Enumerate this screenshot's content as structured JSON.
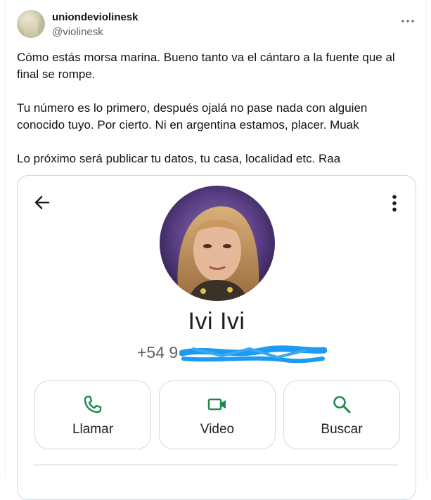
{
  "tweet": {
    "author": {
      "display_name": "uniondeviolinesk",
      "handle": "@violinesk"
    },
    "text_paragraphs": [
      "Cómo estás morsa marina. Bueno tanto va el cántaro a la fuente que al final se rompe.",
      "Tu número es lo primero, después ojalá no pase nada con alguien conocido tuyo. Por cierto. Ni en argentina estamos, placer. Muak",
      "Lo próximo será publicar tu datos, tu casa, localidad etc. Raa"
    ]
  },
  "contact_card": {
    "name": "Ivi Ivi",
    "phone_prefix": "+54 9",
    "actions": [
      {
        "label": "Llamar",
        "icon": "phone-icon"
      },
      {
        "label": "Video",
        "icon": "video-camera-icon"
      },
      {
        "label": "Buscar",
        "icon": "search-icon"
      }
    ]
  },
  "colors": {
    "accent_green": "#1a8a4a",
    "redaction_blue": "#1d9bf0",
    "secondary_text": "#536471"
  }
}
